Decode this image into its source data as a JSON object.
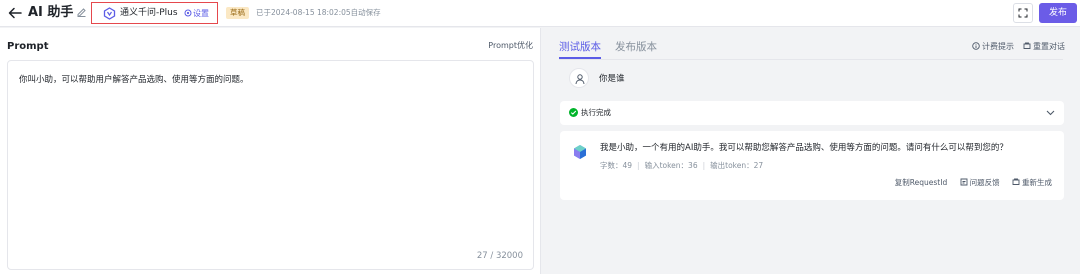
{
  "header": {
    "title": "AI 助手",
    "model_name": "通义千问-Plus",
    "settings_label": "设置",
    "draft_badge": "草稿",
    "save_status": "已于2024-08-15 18:02:05自动保存",
    "publish_label": "发布"
  },
  "prompt": {
    "label": "Prompt",
    "optimize_label": "Prompt优化",
    "text": "你叫小助，可以帮助用户解答产品选购、使用等方面的问题。",
    "counter": "27 / 32000"
  },
  "debug": {
    "tabs": [
      {
        "label": "测试版本",
        "active": true
      },
      {
        "label": "发布版本",
        "active": false
      }
    ],
    "billing_hint": "计费提示",
    "reset_chat": "重置对话",
    "user_message": "你是谁",
    "exec_status": "执行完成",
    "reply": {
      "text": "我是小助，一个有用的AI助手。我可以帮助您解答产品选购、使用等方面的问题。请问有什么可以帮到您的？",
      "char_count": "字数：49",
      "input_tokens": "输入token：36",
      "output_tokens": "输出token：27",
      "copy_request_id": "复制RequestId",
      "feedback": "问题反馈",
      "regenerate": "重新生成"
    }
  },
  "colors": {
    "accent": "#5b5ce6",
    "primary_button": "#6b5ce7",
    "highlight_border": "#e5484d",
    "success": "#00b42a",
    "draft_bg": "#fbe8c4"
  }
}
